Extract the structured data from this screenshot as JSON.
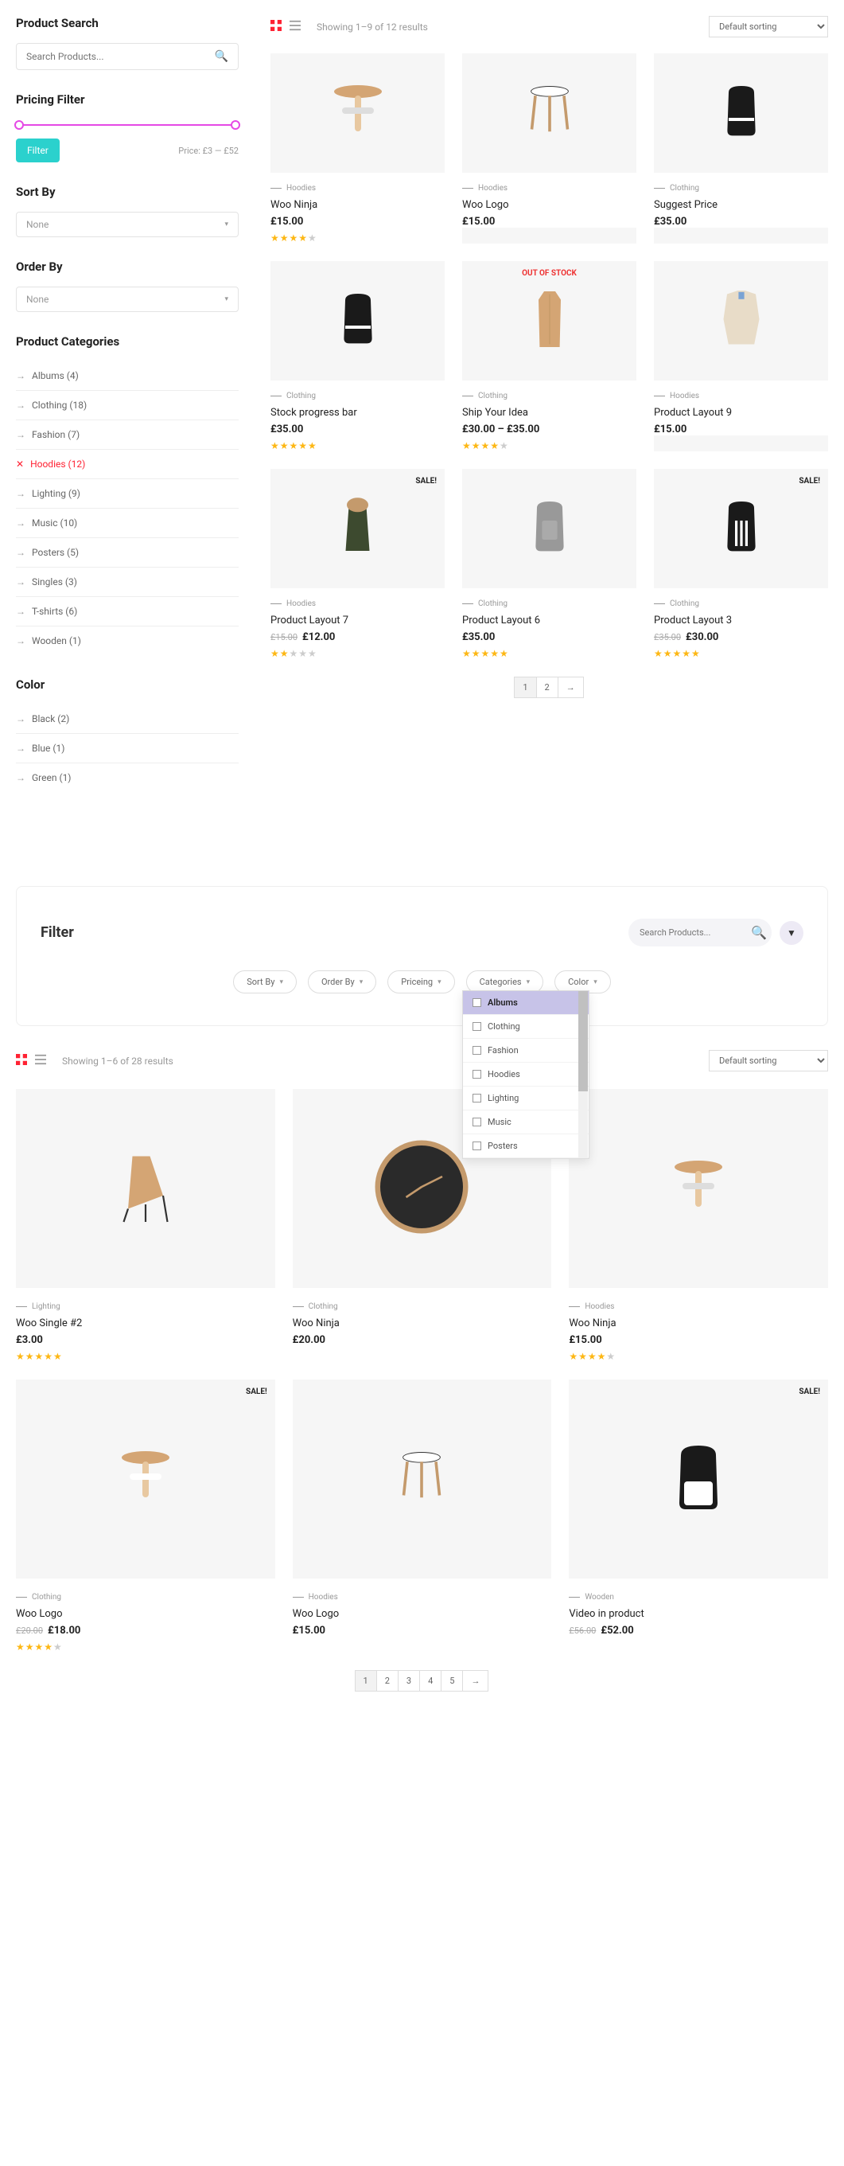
{
  "sidebar": {
    "search_title": "Product Search",
    "search_placeholder": "Search Products...",
    "pricing_title": "Pricing Filter",
    "filter_btn": "Filter",
    "price_text": "Price: £3 — £52",
    "sortby_title": "Sort By",
    "sortby_value": "None",
    "orderby_title": "Order By",
    "orderby_value": "None",
    "cats_title": "Product Categories",
    "cats": [
      {
        "label": "Albums (4)",
        "active": false
      },
      {
        "label": "Clothing (18)",
        "active": false
      },
      {
        "label": "Fashion (7)",
        "active": false
      },
      {
        "label": "Hoodies (12)",
        "active": true
      },
      {
        "label": "Lighting (9)",
        "active": false
      },
      {
        "label": "Music (10)",
        "active": false
      },
      {
        "label": "Posters (5)",
        "active": false
      },
      {
        "label": "Singles (3)",
        "active": false
      },
      {
        "label": "T-shirts (6)",
        "active": false
      },
      {
        "label": "Wooden (1)",
        "active": false
      }
    ],
    "color_title": "Color",
    "colors": [
      {
        "label": "Black (2)"
      },
      {
        "label": "Blue (1)"
      },
      {
        "label": "Green (1)"
      }
    ]
  },
  "top1": {
    "results": "Showing 1–9 of 12 results",
    "sort": "Default sorting"
  },
  "grid1": [
    {
      "cat": "Hoodies",
      "name": "Woo Ninja",
      "price": "£15.00",
      "rating": 4,
      "img": "stool1"
    },
    {
      "cat": "Hoodies",
      "name": "Woo Logo",
      "price": "£15.00",
      "img": "stool2"
    },
    {
      "cat": "Clothing",
      "name": "Suggest Price",
      "price": "£35.00",
      "img": "backpack-black"
    },
    {
      "cat": "Clothing",
      "name": "Stock progress bar",
      "price": "£35.00",
      "rating": 5,
      "img": "backpack-black"
    },
    {
      "cat": "Clothing",
      "name": "Ship Your Idea",
      "price": "£30.00 – £35.00",
      "rating": 4,
      "badge": "OUT OF STOCK",
      "img": "coat"
    },
    {
      "cat": "Hoodies",
      "name": "Product Layout 9",
      "price": "£15.00",
      "img": "jacket"
    },
    {
      "cat": "Hoodies",
      "name": "Product Layout 7",
      "price": "£12.00",
      "old": "£15.00",
      "rating": 2,
      "badge": "SALE!",
      "img": "parka"
    },
    {
      "cat": "Clothing",
      "name": "Product Layout 6",
      "price": "£35.00",
      "rating": 4.5,
      "img": "backpack-grey"
    },
    {
      "cat": "Clothing",
      "name": "Product Layout 3",
      "price": "£30.00",
      "old": "£35.00",
      "rating": 4.5,
      "badge": "SALE!",
      "img": "backpack-stripe"
    }
  ],
  "pag1": [
    "1",
    "2",
    "→"
  ],
  "filter2": {
    "title": "Filter",
    "search_placeholder": "Search Products...",
    "pills": [
      "Sort By",
      "Order By",
      "Priceing",
      "Categories",
      "Color"
    ],
    "dropdown": [
      "Albums",
      "Clothing",
      "Fashion",
      "Hoodies",
      "Lighting",
      "Music",
      "Posters"
    ]
  },
  "top2": {
    "results": "Showing 1–6 of 28 results",
    "sort": "Default sorting"
  },
  "grid2": [
    {
      "cat": "Lighting",
      "name": "Woo Single #2",
      "price": "£3.00",
      "rating": 4.5,
      "img": "chair"
    },
    {
      "cat": "Clothing",
      "name": "Woo Ninja",
      "price": "£20.00",
      "img": "clock"
    },
    {
      "cat": "Hoodies",
      "name": "Woo Ninja",
      "price": "£15.00",
      "rating": 4,
      "img": "stool1"
    },
    {
      "cat": "Clothing",
      "name": "Woo Logo",
      "price": "£18.00",
      "old": "£20.00",
      "rating": 4,
      "badge": "SALE!",
      "img": "stool1b"
    },
    {
      "cat": "Hoodies",
      "name": "Woo Logo",
      "price": "£15.00",
      "img": "stool2"
    },
    {
      "cat": "Wooden",
      "name": "Video in product",
      "price": "£52.00",
      "old": "£56.00",
      "badge": "SALE!",
      "img": "backpack-bw"
    }
  ],
  "pag2": [
    "1",
    "2",
    "3",
    "4",
    "5",
    "→"
  ]
}
